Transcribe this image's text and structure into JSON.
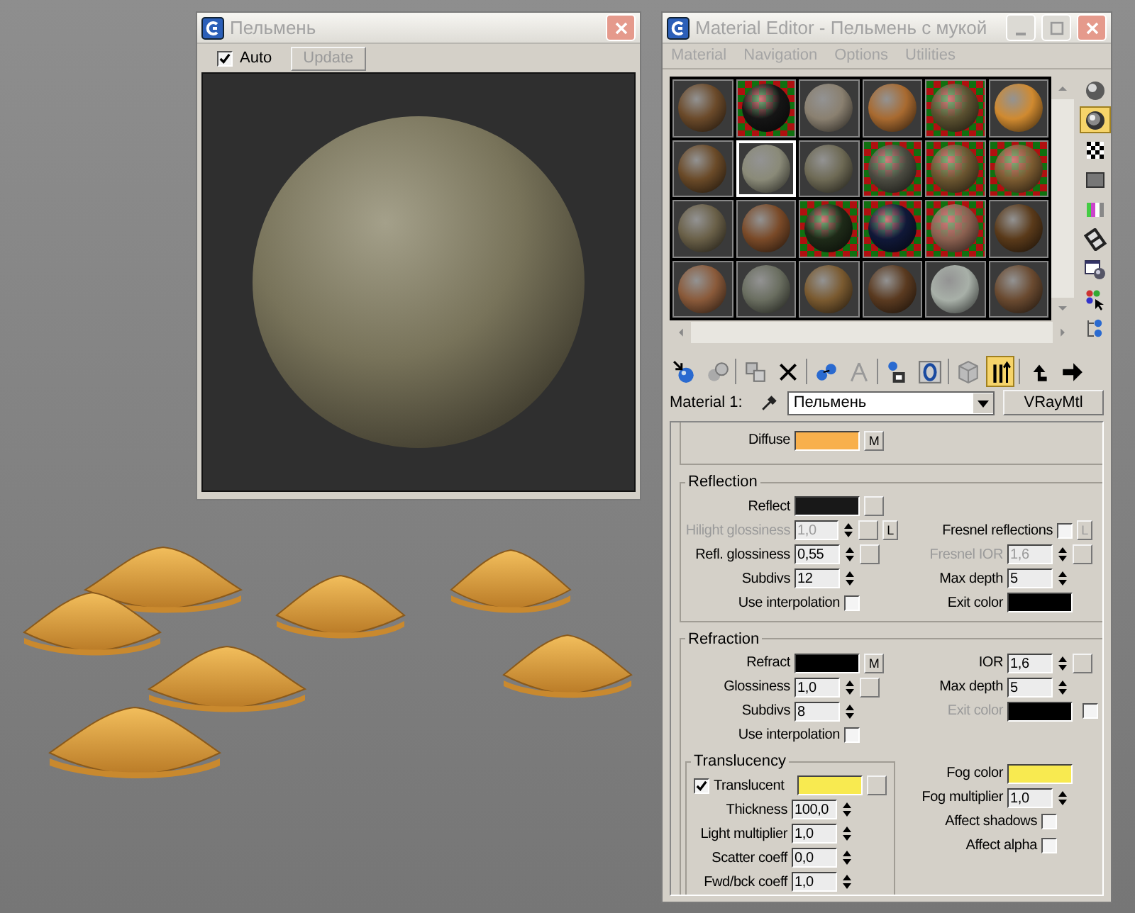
{
  "preview_window": {
    "title": "Пельмень",
    "auto": {
      "label": "Auto",
      "checked": true
    },
    "update_button": {
      "label": "Update",
      "disabled": true
    }
  },
  "material_editor": {
    "title": "Material Editor - Пельмень с мукой",
    "menu": [
      "Material",
      "Navigation",
      "Options",
      "Utilities"
    ],
    "slots": [
      {
        "color": "#6b4a2a",
        "backdrop": false,
        "selected": false
      },
      {
        "color": "#151515",
        "backdrop": true,
        "selected": false
      },
      {
        "color": "#8a8070",
        "backdrop": false,
        "selected": false
      },
      {
        "color": "#a86a30",
        "backdrop": false,
        "selected": false
      },
      {
        "color": "#5a5030",
        "backdrop": true,
        "selected": false
      },
      {
        "color": "#d08a30",
        "backdrop": false,
        "selected": false
      },
      {
        "color": "#6a4a28",
        "backdrop": false,
        "selected": false
      },
      {
        "color": "#8a8a78",
        "backdrop": false,
        "selected": true
      },
      {
        "color": "#6e6a55",
        "backdrop": false,
        "selected": false
      },
      {
        "color": "#4a4a40",
        "backdrop": true,
        "selected": false
      },
      {
        "color": "#6a5530",
        "backdrop": true,
        "selected": false
      },
      {
        "color": "#7a5a30",
        "backdrop": true,
        "selected": false
      },
      {
        "color": "#6a6048",
        "backdrop": false,
        "selected": false
      },
      {
        "color": "#7a4a28",
        "backdrop": false,
        "selected": false
      },
      {
        "color": "#1e2a18",
        "backdrop": true,
        "selected": false
      },
      {
        "color": "#101838",
        "backdrop": true,
        "selected": false
      },
      {
        "color": "#8a6050",
        "backdrop": true,
        "selected": false
      },
      {
        "color": "#5a3a1a",
        "backdrop": false,
        "selected": false
      },
      {
        "color": "#8a5a3a",
        "backdrop": false,
        "selected": false
      },
      {
        "color": "#6a6e60",
        "backdrop": false,
        "selected": false
      },
      {
        "color": "#7a5a30",
        "backdrop": false,
        "selected": false
      },
      {
        "color": "#5a3a20",
        "backdrop": false,
        "selected": false
      },
      {
        "color": "#a8b0a8",
        "backdrop": false,
        "selected": false
      },
      {
        "color": "#6a4a30",
        "backdrop": false,
        "selected": false
      }
    ],
    "side_tools": [
      {
        "kind": "sample-sphere",
        "active": false
      },
      {
        "kind": "backlight",
        "active": true
      },
      {
        "kind": "checker",
        "active": false
      },
      {
        "kind": "sample-uv",
        "active": false
      },
      {
        "kind": "color-check",
        "active": false
      },
      {
        "kind": "film",
        "active": false
      },
      {
        "kind": "options",
        "active": false
      },
      {
        "kind": "select-by-material",
        "active": false
      },
      {
        "kind": "navigator",
        "active": false
      }
    ],
    "toolbar": [
      {
        "kind": "get-material",
        "active": false
      },
      {
        "kind": "put-to-scene",
        "active": false
      },
      {
        "kind": "assign",
        "active": false
      },
      {
        "kind": "delete",
        "active": false
      },
      {
        "kind": "copy",
        "active": false
      },
      {
        "kind": "unique",
        "active": false
      },
      {
        "kind": "library",
        "active": false
      },
      {
        "kind": "material-id",
        "active": false
      },
      {
        "kind": "show-map",
        "active": false
      },
      {
        "kind": "end-result",
        "active": true
      },
      {
        "kind": "parent",
        "active": false
      },
      {
        "kind": "sibling",
        "active": false
      }
    ],
    "material_label": "Material 1:",
    "material_name": "Пельмень",
    "material_type": "VRayMtl",
    "groups": [
      {
        "kind": "clipped",
        "rows": [
          {
            "left": {
              "kind": "color",
              "label": "Diffuse",
              "color": "#f8b04c",
              "disabled": false,
              "after": [
                {
                  "kind": "map",
                  "text": "M"
                }
              ]
            }
          }
        ]
      },
      {
        "kind": "group",
        "title": "Reflection",
        "rows": [
          {
            "left": {
              "kind": "color",
              "label": "Reflect",
              "color": "#181818",
              "disabled": false,
              "after": [
                {
                  "kind": "map"
                }
              ]
            }
          },
          {
            "left": {
              "kind": "spinner",
              "label": "Hilight glossiness",
              "value": "1,0",
              "disabled": true,
              "after": [
                {
                  "kind": "map"
                },
                {
                  "kind": "lock",
                  "text": "L",
                  "disabled": false
                }
              ]
            },
            "right": {
              "kind": "checkbox",
              "label": "Fresnel reflections",
              "checked": false,
              "disabled": false,
              "after": [
                {
                  "kind": "lock",
                  "text": "L",
                  "disabled": true
                }
              ]
            }
          },
          {
            "left": {
              "kind": "spinner",
              "label": "Refl. glossiness",
              "value": "0,55",
              "disabled": false,
              "after": [
                {
                  "kind": "map"
                }
              ]
            },
            "right": {
              "kind": "spinner",
              "label": "Fresnel IOR",
              "value": "1,6",
              "disabled": true,
              "after": [
                {
                  "kind": "map"
                }
              ]
            }
          },
          {
            "left": {
              "kind": "spinner",
              "label": "Subdivs",
              "value": "12",
              "disabled": false
            },
            "right": {
              "kind": "spinner",
              "label": "Max depth",
              "value": "5",
              "disabled": false
            }
          },
          {
            "left": {
              "kind": "checkbox",
              "label": "Use interpolation",
              "checked": false,
              "disabled": false
            },
            "right": {
              "kind": "color",
              "label": "Exit color",
              "color": "#000000",
              "disabled": false
            }
          }
        ]
      },
      {
        "kind": "group",
        "title": "Refraction",
        "rows": [
          {
            "left": {
              "kind": "color",
              "label": "Refract",
              "color": "#000000",
              "disabled": false,
              "after": [
                {
                  "kind": "map",
                  "text": "M"
                }
              ]
            },
            "right": {
              "kind": "spinner",
              "label": "IOR",
              "value": "1,6",
              "disabled": false,
              "after": [
                {
                  "kind": "map"
                }
              ]
            }
          },
          {
            "left": {
              "kind": "spinner",
              "label": "Glossiness",
              "value": "1,0",
              "disabled": false,
              "after": [
                {
                  "kind": "map"
                }
              ]
            },
            "right": {
              "kind": "spinner",
              "label": "Max depth",
              "value": "5",
              "disabled": false
            }
          },
          {
            "left": {
              "kind": "spinner",
              "label": "Subdivs",
              "value": "8",
              "disabled": false
            },
            "right": {
              "kind": "color",
              "label": "Exit color",
              "color": "#000000",
              "disabled": true,
              "after": [
                {
                  "kind": "checkbox",
                  "checked": false
                }
              ]
            }
          },
          {
            "left": {
              "kind": "checkbox",
              "label": "Use interpolation",
              "checked": false,
              "disabled": false
            }
          }
        ],
        "subgroup": {
          "title": "Translucency",
          "rows": [
            {
              "kind": "checkbox_color",
              "label": "Translucent",
              "checked": true,
              "color": "#f8ea50",
              "disabled": false,
              "after": [
                {
                  "kind": "map"
                }
              ]
            },
            {
              "kind": "spinner",
              "label": "Thickness",
              "value": "100,0",
              "disabled": false
            },
            {
              "kind": "spinner",
              "label": "Light multiplier",
              "value": "1,0",
              "disabled": false
            },
            {
              "kind": "spinner",
              "label": "Scatter coeff",
              "value": "0,0",
              "disabled": false
            },
            {
              "kind": "spinner",
              "label": "Fwd/bck coeff",
              "value": "1,0",
              "disabled": false
            }
          ]
        },
        "side": [
          {
            "kind": "color",
            "label": "Fog color",
            "color": "#f8ea50",
            "disabled": false
          },
          {
            "kind": "spinner",
            "label": "Fog multiplier",
            "value": "1,0",
            "disabled": false
          },
          {
            "kind": "checkbox",
            "label": "Affect shadows",
            "checked": false,
            "disabled": false
          },
          {
            "kind": "checkbox",
            "label": "Affect alpha",
            "checked": false,
            "disabled": false
          }
        ]
      }
    ]
  }
}
